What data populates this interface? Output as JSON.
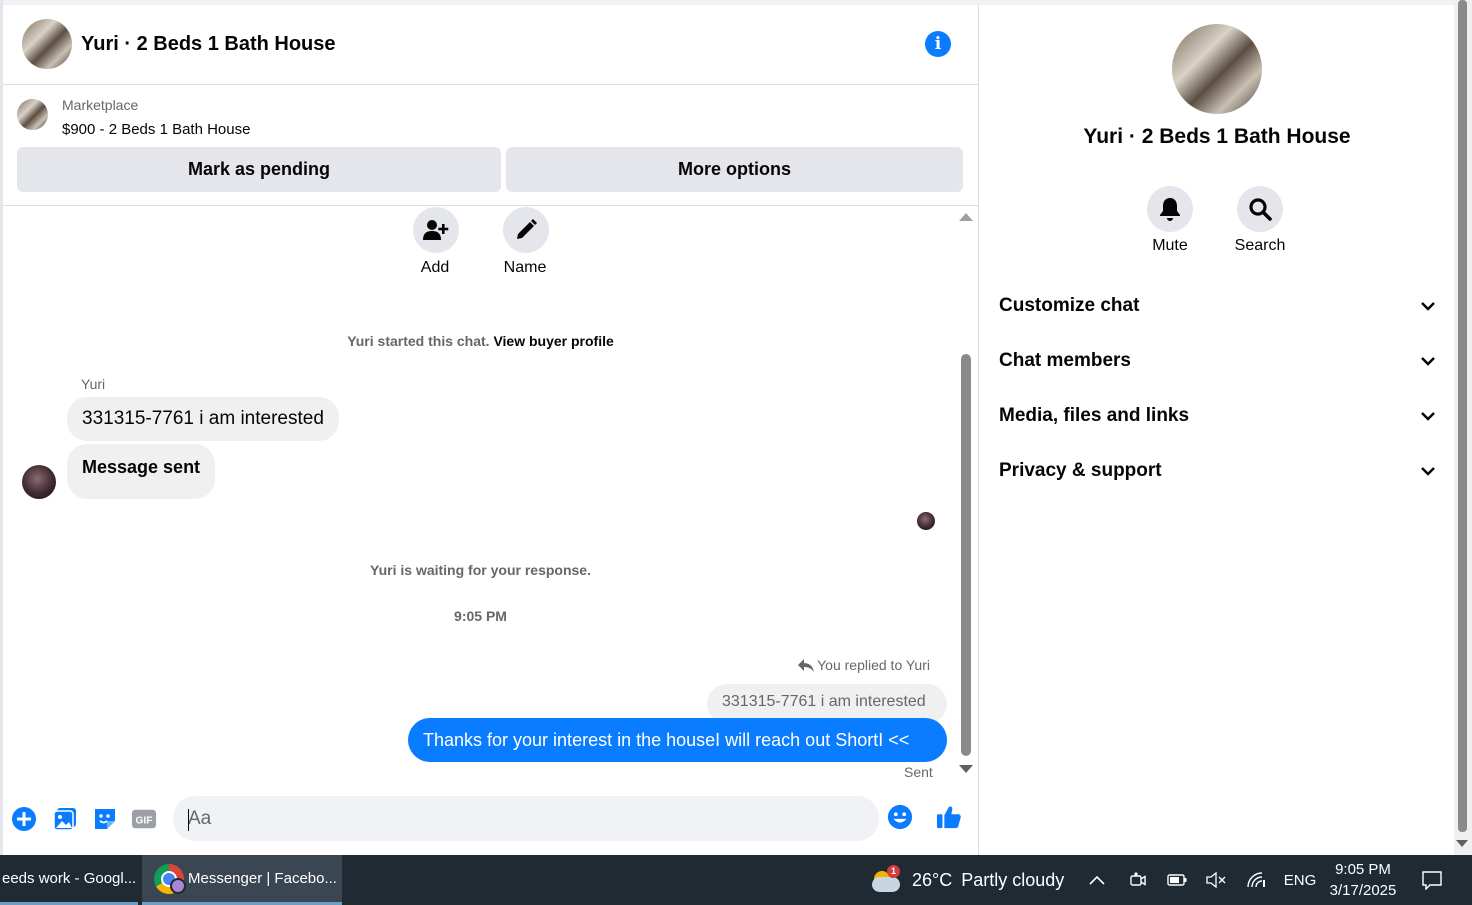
{
  "conversation": {
    "title": "Yuri · 2 Beds 1 Bath House"
  },
  "marketplace": {
    "label": "Marketplace",
    "item": "$900 - 2 Beds 1 Bath House",
    "pending_button": "Mark as pending",
    "more_button": "More options"
  },
  "actions": {
    "add_label": "Add",
    "name_label": "Name"
  },
  "chat": {
    "started_text": "Yuri started this chat.",
    "buyer_profile_link": "View buyer profile",
    "sender_name": "Yuri",
    "incoming_messages": [
      "331315-7761  i am interested",
      "Message sent"
    ],
    "waiting_text": "Yuri is waiting for your response.",
    "timestamp": "9:05 PM",
    "replied_to": "You replied to Yuri",
    "quoted_message": "331315-7761  i am interested",
    "outgoing_message": "Thanks for your interest in the houseI will reach out ShortI <<",
    "status": "Sent"
  },
  "composer": {
    "placeholder": "Aa"
  },
  "details": {
    "title": "Yuri · 2 Beds 1 Bath House",
    "mute_label": "Mute",
    "search_label": "Search",
    "sections": [
      "Customize chat",
      "Chat members",
      "Media, files and links",
      "Privacy & support"
    ]
  },
  "taskbar": {
    "task1_label": "eeds work - Googl...",
    "task2_label": "Messenger | Facebo...",
    "weather_temp": "26°C",
    "weather_desc": "Partly cloudy",
    "weather_badge": "1",
    "language": "ENG",
    "time": "9:05 PM",
    "date": "3/17/2025"
  },
  "colors": {
    "accent": "#0a7cff",
    "bubble_in": "#f0f0f0",
    "button_gray": "#e4e6eb",
    "taskbar": "#1f2a33"
  },
  "icons": {
    "info": "info-icon",
    "add_person": "add-person-icon",
    "pencil": "pencil-icon",
    "bell": "bell-icon",
    "search": "search-icon",
    "chevron": "chevron-down-icon",
    "reply": "reply-icon",
    "plus": "plus-icon",
    "photo": "photo-icon",
    "sticker": "sticker-icon",
    "gif": "gif-icon",
    "emoji": "emoji-icon",
    "thumbs_up": "thumbs-up-icon"
  }
}
